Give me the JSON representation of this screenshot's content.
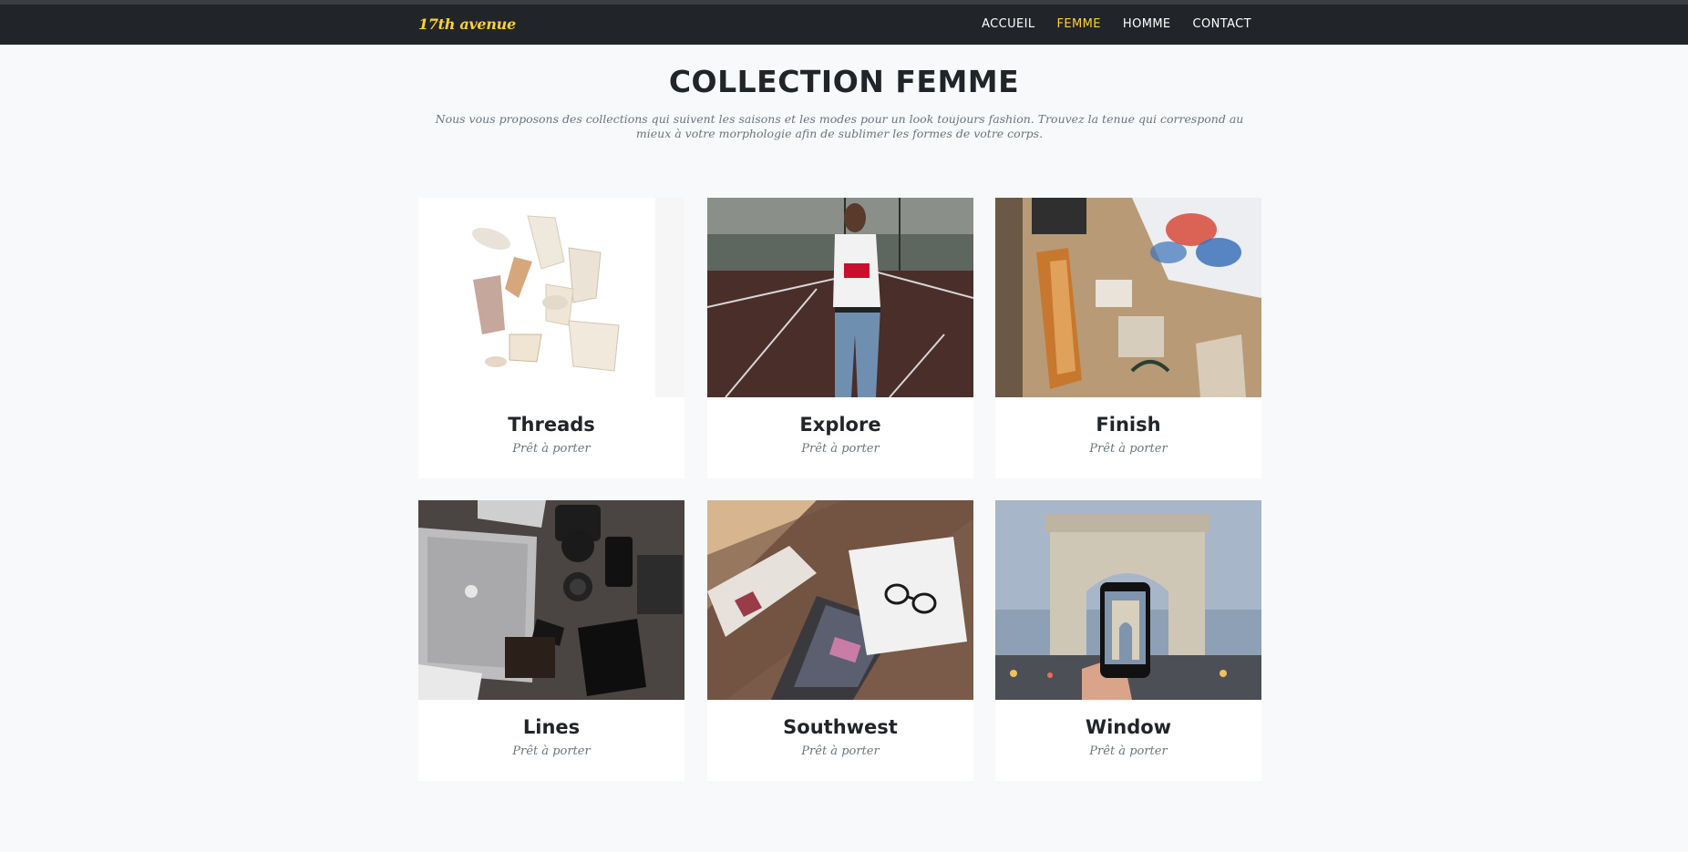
{
  "header": {
    "brand": "17th avenue",
    "nav": [
      "ACCUEIL",
      "FEMME",
      "HOMME",
      "CONTACT"
    ],
    "active_nav": "FEMME"
  },
  "section": {
    "title": "COLLECTION FEMME",
    "subtitle": "Nous vous proposons des collections qui suivent les saisons et les modes pour un look toujours fashion. Trouvez la tenue qui correspond au mieux à votre morphologie afin de sublimer les formes de votre corps."
  },
  "cards": [
    {
      "title": "Threads",
      "subtitle": "Prêt à porter"
    },
    {
      "title": "Explore",
      "subtitle": "Prêt à porter"
    },
    {
      "title": "Finish",
      "subtitle": "Prêt à porter"
    },
    {
      "title": "Lines",
      "subtitle": "Prêt à porter"
    },
    {
      "title": "Southwest",
      "subtitle": "Prêt à porter"
    },
    {
      "title": "Window",
      "subtitle": "Prêt à porter"
    }
  ],
  "colors": {
    "accent": "#fed136",
    "navbar": "#212529",
    "page_bg": "#f8f9fa",
    "text_dark": "#212529",
    "text_muted": "#6c757d"
  }
}
